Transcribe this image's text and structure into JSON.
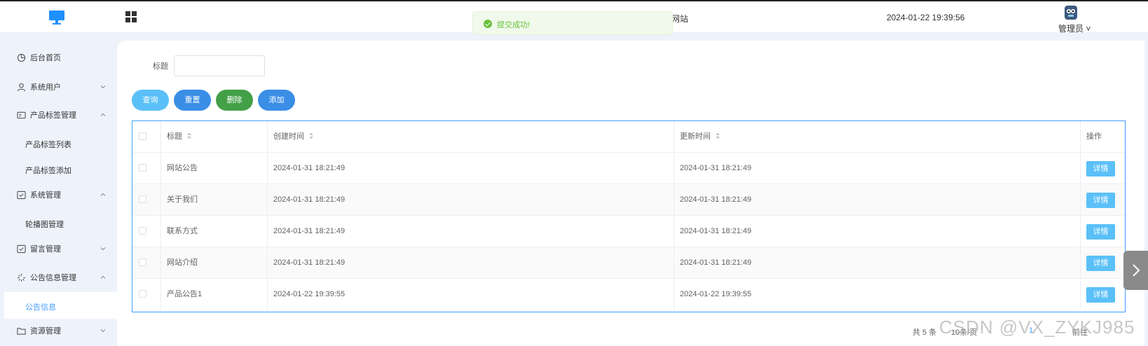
{
  "header": {
    "site_title": "网站",
    "datetime": "2024-01-22 19:39:56",
    "user_name": "管理员"
  },
  "toast": {
    "text": "提交成功!",
    "color": "#67c23a"
  },
  "sidebar": {
    "items": [
      {
        "label": "后台首页",
        "icon": "pie-chart-icon"
      },
      {
        "label": "系统用户",
        "icon": "user-icon",
        "expanded": false
      },
      {
        "label": "产品标签管理",
        "icon": "id-card-icon",
        "expanded": true
      },
      {
        "label": "产品标签列表"
      },
      {
        "label": "产品标签添加"
      },
      {
        "label": "系统管理",
        "icon": "window-check-icon",
        "expanded": true
      },
      {
        "label": "轮播图管理"
      },
      {
        "label": "留言管理",
        "icon": "window-check-icon",
        "expanded": false
      },
      {
        "label": "公告信息管理",
        "icon": "loading-icon",
        "expanded": true
      },
      {
        "label": "公告信息",
        "active": true
      },
      {
        "label": "资源管理",
        "icon": "folder-icon",
        "expanded": false
      }
    ]
  },
  "filter": {
    "title_label": "标题",
    "title_value": ""
  },
  "buttons": {
    "query": "查询",
    "reset": "重置",
    "delete": "删除",
    "add": "添加"
  },
  "table": {
    "headers": {
      "title": "标题",
      "created": "创建时间",
      "updated": "更新时间",
      "op": "操作"
    },
    "rows": [
      {
        "title": "网站公告",
        "created": "2024-01-31 18:21:49",
        "updated": "2024-01-31 18:21:49",
        "action": "详情"
      },
      {
        "title": "关于我们",
        "created": "2024-01-31 18:21:49",
        "updated": "2024-01-31 18:21:49",
        "action": "详情"
      },
      {
        "title": "联系方式",
        "created": "2024-01-31 18:21:49",
        "updated": "2024-01-31 18:21:49",
        "action": "详情"
      },
      {
        "title": "网站介绍",
        "created": "2024-01-31 18:21:49",
        "updated": "2024-01-31 18:21:49",
        "action": "详情"
      },
      {
        "title": "产品公告1",
        "created": "2024-01-22 19:39:55",
        "updated": "2024-01-22 19:39:55",
        "action": "详情"
      }
    ]
  },
  "pagination": {
    "total": "共 5 条",
    "page_size": "10条/页",
    "current_page": "1",
    "goto": "前往"
  },
  "watermark": "CSDN @VX_ZYKJ985",
  "colors": {
    "accent": "#409eff",
    "success": "#67c23a",
    "delete": "#43a047",
    "query": "#5bc0f8"
  }
}
